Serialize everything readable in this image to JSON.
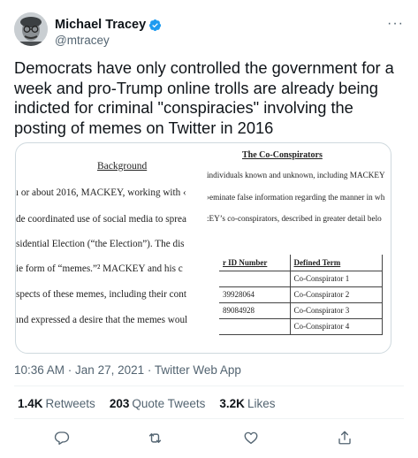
{
  "user": {
    "display_name": "Michael Tracey",
    "handle": "@mtracey",
    "verified_icon": "verified-badge-icon",
    "more_label": "···"
  },
  "tweet": {
    "text": "Democrats have only controlled the government for a week and pro-Trump online trolls are already being indicted for criminal \"conspiracies\" involving the posting of memes on Twitter in 2016",
    "time": "10:36 AM",
    "date": "Jan 27, 2021",
    "client": "Twitter Web App",
    "separator": " · "
  },
  "document": {
    "left": {
      "heading": "Background",
      "lines": [
        "ı or about 2016, MACKEY, working with ‹",
        "de coordinated use of social media to sprea",
        "sidential Election (“the Election”).  The dis",
        "ie form of “memes.”² MACKEY and his c",
        "spects of these memes, including their cont",
        "ınd expressed a desire that the memes woul"
      ]
    },
    "right": {
      "heading": "The Co-Conspirators",
      "lines": [
        "individuals known and unknown, including MACKEY",
        "›eminate false information regarding the manner in wh",
        ":EY’s co-conspirators, described in greater detail belo"
      ],
      "table": {
        "headers": [
          "r ID Number",
          "Defined Term"
        ],
        "rows": [
          [
            "",
            "Co-Conspirator 1"
          ],
          [
            "39928064",
            "Co-Conspirator 2"
          ],
          [
            "89084928",
            "Co-Conspirator 3"
          ],
          [
            "",
            "Co-Conspirator 4"
          ]
        ]
      }
    }
  },
  "stats": {
    "retweets_count": "1.4K",
    "retweets_label": "Retweets",
    "quotes_count": "203",
    "quotes_label": "Quote Tweets",
    "likes_count": "3.2K",
    "likes_label": "Likes"
  },
  "actions": {
    "reply_icon": "reply-icon",
    "retweet_icon": "retweet-icon",
    "like_icon": "like-icon",
    "share_icon": "share-icon"
  },
  "colors": {
    "text_primary": "#0f1419",
    "text_secondary": "#536471",
    "verified_blue": "#1d9bf0",
    "divider": "#eff3f4"
  }
}
